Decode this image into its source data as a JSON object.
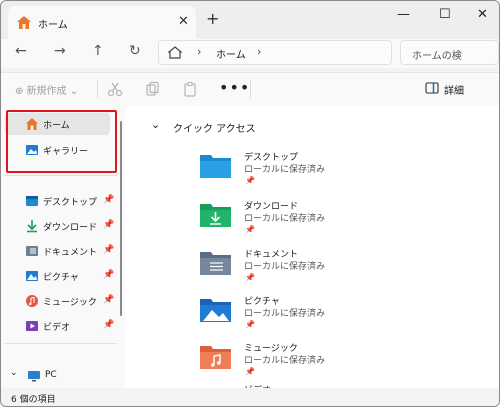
{
  "tab": {
    "title": "ホーム",
    "close": "✕",
    "new": "+"
  },
  "window_controls": {
    "minimize": "—",
    "maximize": "☐",
    "close": "✕"
  },
  "nav": {
    "back": "←",
    "forward": "→",
    "up": "↑",
    "refresh": "↻"
  },
  "address": {
    "separator1": "›",
    "crumb": "ホーム",
    "separator2": "›"
  },
  "search": {
    "placeholder": "ホームの検"
  },
  "toolbar": {
    "new_label": "⊕ 新規作成 ⌄",
    "more": "•••",
    "details_label": "詳細"
  },
  "sidebar": {
    "pinned": [
      {
        "label": "ホーム"
      },
      {
        "label": "ギャラリー"
      }
    ],
    "quick": [
      {
        "label": "デスクトップ",
        "pin": "📌"
      },
      {
        "label": "ダウンロード",
        "pin": "📌"
      },
      {
        "label": "ドキュメント",
        "pin": "📌"
      },
      {
        "label": "ピクチャ",
        "pin": "📌"
      },
      {
        "label": "ミュージック",
        "pin": "📌"
      },
      {
        "label": "ビデオ",
        "pin": "📌"
      }
    ],
    "pc": {
      "chevron": "⌄",
      "label": "PC"
    }
  },
  "quick_access": {
    "chevron": "⌄",
    "title": "クイック アクセス",
    "folders": [
      {
        "name": "デスクトップ",
        "sub": "ローカルに保存済み",
        "pin": "📌"
      },
      {
        "name": "ダウンロード",
        "sub": "ローカルに保存済み",
        "pin": "📌"
      },
      {
        "name": "ドキュメント",
        "sub": "ローカルに保存済み",
        "pin": "📌"
      },
      {
        "name": "ピクチャ",
        "sub": "ローカルに保存済み",
        "pin": "📌"
      },
      {
        "name": "ミュージック",
        "sub": "ローカルに保存済み",
        "pin": "📌"
      },
      {
        "name": "ビデオ"
      }
    ]
  },
  "status": {
    "text": "6 個の項目"
  },
  "colors": {
    "highlight": "#e0141e",
    "accent": "#0067c0",
    "home_orange": "#e8762b"
  }
}
